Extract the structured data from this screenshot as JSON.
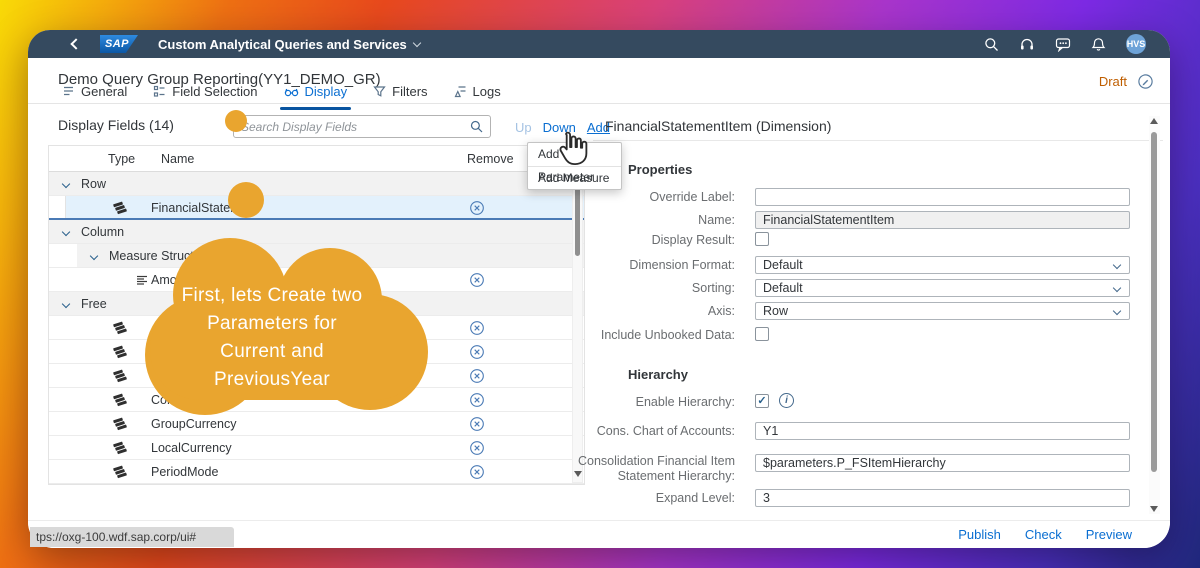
{
  "shell": {
    "logo_text": "SAP",
    "app_title": "Custom Analytical Queries and Services",
    "avatar_initials": "HVS"
  },
  "page": {
    "title": "Demo Query Group Reporting(YY1_DEMO_GR)",
    "status": "Draft"
  },
  "tabs": [
    {
      "label": "General"
    },
    {
      "label": "Field Selection"
    },
    {
      "label": "Display"
    },
    {
      "label": "Filters"
    },
    {
      "label": "Logs"
    }
  ],
  "display_fields": {
    "title": "Display Fields (14)",
    "search_placeholder": "Search Display Fields",
    "actions": {
      "up": "Up",
      "down": "Down",
      "add": "Add"
    },
    "add_menu": {
      "items": [
        {
          "label": "Add Parameter"
        },
        {
          "label": "Add Measure"
        }
      ]
    },
    "columns": {
      "type": "Type",
      "name": "Name",
      "remove": "Remove"
    },
    "rows": [
      {
        "kind": "group",
        "label": "Row"
      },
      {
        "kind": "item",
        "icon": "dimension-icon",
        "label": "FinancialStatement",
        "selected": true
      },
      {
        "kind": "group",
        "label": "Column"
      },
      {
        "kind": "subgroup",
        "label": "Measure Structure"
      },
      {
        "kind": "item",
        "icon": "measure-icon",
        "label": "Amou"
      },
      {
        "kind": "group",
        "label": "Free"
      },
      {
        "kind": "item",
        "icon": "dimension-icon",
        "label": ""
      },
      {
        "kind": "item",
        "icon": "dimension-icon",
        "label": ""
      },
      {
        "kind": "item",
        "icon": "dimension-icon",
        "label": ""
      },
      {
        "kind": "item",
        "icon": "dimension-icon",
        "label": "Cons"
      },
      {
        "kind": "item",
        "icon": "dimension-icon",
        "label": "GroupCurrency"
      },
      {
        "kind": "item",
        "icon": "dimension-icon",
        "label": "LocalCurrency"
      },
      {
        "kind": "item",
        "icon": "dimension-icon",
        "label": "PeriodMode"
      }
    ]
  },
  "properties_panel": {
    "title": "FinancialStatementItem (Dimension)",
    "properties_section": "Properties",
    "fields": {
      "override_label": {
        "label": "Override Label:",
        "value": ""
      },
      "name": {
        "label": "Name:",
        "value": "FinancialStatementItem"
      },
      "display_result": {
        "label": "Display Result:",
        "checked": false
      },
      "dimension_format": {
        "label": "Dimension Format:",
        "value": "Default"
      },
      "sorting": {
        "label": "Sorting:",
        "value": "Default"
      },
      "axis": {
        "label": "Axis:",
        "value": "Row"
      },
      "include_unbooked": {
        "label": "Include Unbooked Data:",
        "checked": false
      }
    },
    "hierarchy_section": "Hierarchy",
    "hierarchy_fields": {
      "enable_hierarchy": {
        "label": "Enable Hierarchy:",
        "checked": true,
        "checkmark": "✓"
      },
      "cons_chart_of_accounts": {
        "label": "Cons. Chart of Accounts:",
        "value": "Y1"
      },
      "consolidation_hierarchy": {
        "label": "Consolidation Financial Item Statement Hierarchy:",
        "value": "$parameters.P_FSItemHierarchy"
      },
      "expand_level": {
        "label": "Expand Level:",
        "value": "3"
      }
    }
  },
  "annotation": {
    "text_lines": [
      "First, lets Create two",
      "Parameters for",
      "Current and",
      "PreviousYear"
    ]
  },
  "footer": {
    "links": [
      {
        "label": "Publish"
      },
      {
        "label": "Check"
      },
      {
        "label": "Preview"
      }
    ]
  },
  "status_bar": {
    "url": "tps://oxg-100.wdf.sap.corp/ui#"
  },
  "colors": {
    "shell_bar": "#354a5f",
    "accent_blue": "#0a6ed1",
    "annotation_orange": "#e9a52f",
    "draft_orange": "#bf5e00",
    "selected_row": "#e3f1fc"
  }
}
